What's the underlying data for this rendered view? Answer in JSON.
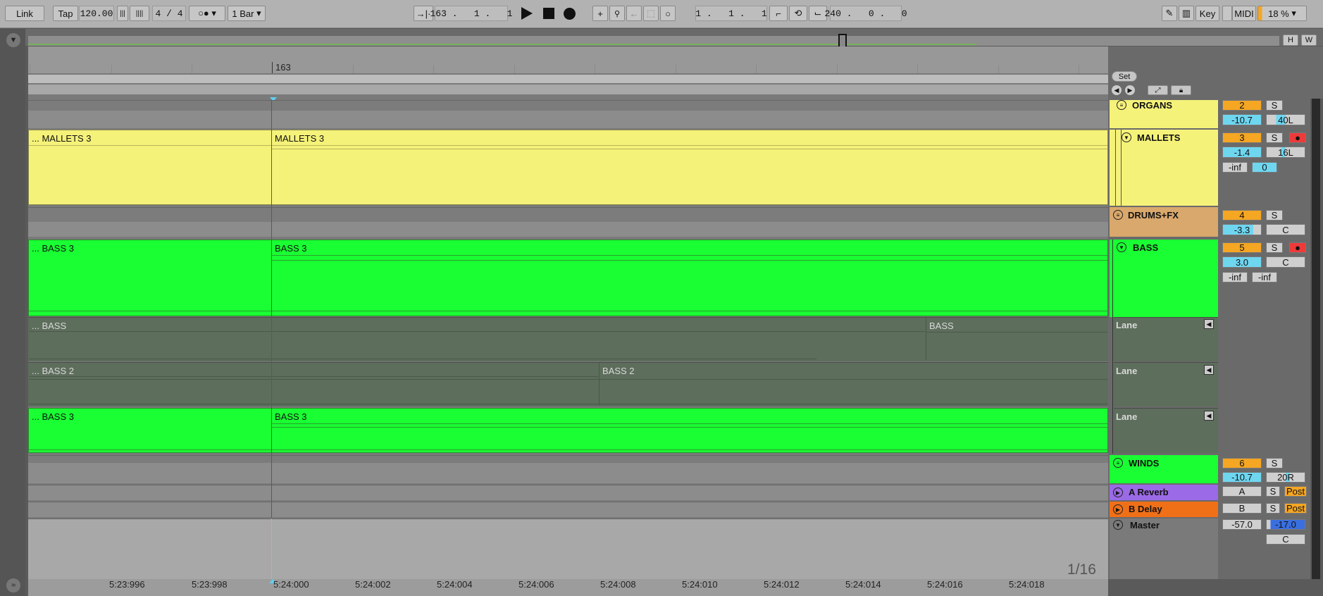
{
  "transport": {
    "link": "Link",
    "tap": "Tap",
    "tempo": "120.00",
    "signature": "4 / 4",
    "quantize": "1 Bar",
    "position": "163 .   1 .   1",
    "loop_start": "1 .   1 .   1",
    "loop_length": "240 .   0 .   0",
    "key": "Key",
    "midi": "MIDI",
    "cpu": "18 %"
  },
  "overview": {
    "h_label": "H",
    "w_label": "W"
  },
  "ruler": {
    "bar_label": "163",
    "set_label": "Set"
  },
  "time_labels": [
    "5:23:996",
    "5:23:998",
    "5:24:000",
    "5:24:002",
    "5:24:004",
    "5:24:006",
    "5:24:008",
    "5:24:010",
    "5:24:012",
    "5:24:014",
    "5:24:016",
    "5:24:018"
  ],
  "grid_label": "1/16",
  "clips": {
    "mallets_left": "... MALLETS 3",
    "mallets_right": "MALLETS 3",
    "bass_left": "... BASS 3",
    "bass_right": "BASS 3",
    "lane1_left": "... BASS",
    "lane1_right": "BASS",
    "lane2_left": "... BASS 2",
    "lane2_right": "BASS 2",
    "lane3_left": "... BASS 3",
    "lane3_right": "BASS 3"
  },
  "tracks": {
    "organs": {
      "name": "ORGANS",
      "num": "2",
      "solo": "S",
      "vol": "-10.7",
      "pan": "40L"
    },
    "mallets": {
      "name": "MALLETS",
      "num": "3",
      "solo": "S",
      "vol": "-1.4",
      "pan": "16L",
      "meter_l": "-inf",
      "meter_r": "0"
    },
    "drums": {
      "name": "DRUMS+FX",
      "num": "4",
      "solo": "S",
      "vol": "-3.3",
      "pan": "C"
    },
    "bass": {
      "name": "BASS",
      "num": "5",
      "solo": "S",
      "vol": "3.0",
      "pan": "C",
      "meter_l": "-inf",
      "meter_r": "-inf"
    },
    "lanes": [
      "Lane",
      "Lane",
      "Lane"
    ],
    "winds": {
      "name": "WINDS",
      "num": "6",
      "solo": "S",
      "vol": "-10.7",
      "pan": "20R"
    },
    "reverb": {
      "name": "A Reverb",
      "num": "A",
      "solo": "S",
      "post": "Post"
    },
    "delay": {
      "name": "B Delay",
      "num": "B",
      "solo": "S",
      "post": "Post"
    },
    "master": {
      "name": "Master",
      "vol": "-57.0",
      "gain": "-17.0",
      "pan": "C"
    }
  },
  "colors": {
    "yellow": "#f5f27a",
    "green": "#19ff33",
    "lane_bg": "#5d6e5c",
    "drums": "#d9a86c",
    "reverb": "#9b6ae6",
    "delay": "#f07018"
  }
}
